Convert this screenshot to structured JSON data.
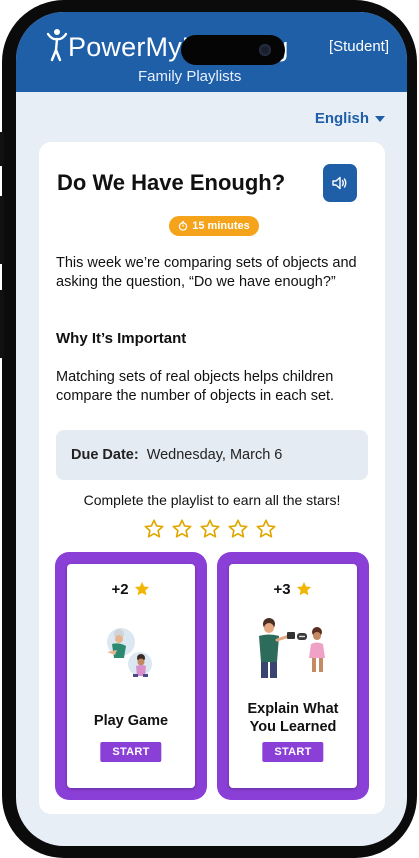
{
  "header": {
    "logo_text": "PowerMyLearning",
    "logo_sub": "Family Playlists",
    "role": "[Student]"
  },
  "language": {
    "selected": "English"
  },
  "activity": {
    "title": "Do We Have Enough?",
    "duration": "15 minutes",
    "description": "This week we’re comparing sets of objects and asking the question, “Do we have enough?”",
    "why_heading": "Why It’s Important",
    "why_text": "Matching sets of real objects helps children compare the number of objects in each set.",
    "due_label": "Due Date:",
    "due_value": "Wednesday, March 6",
    "stars_prompt": "Complete the playlist to earn all the stars!",
    "stars_total": 5,
    "stars_earned": 0
  },
  "tiles": [
    {
      "points": "+2",
      "label": "Play Game",
      "button": "START"
    },
    {
      "points": "+3",
      "label": "Explain What You Learned",
      "button": "START"
    }
  ],
  "colors": {
    "header_blue": "#1f5fa8",
    "badge_orange": "#f5a31a",
    "accent_purple": "#8a3fd6",
    "star_yellow": "#f2b705"
  },
  "icons": [
    "person-logo-icon",
    "speaker-icon",
    "timer-icon",
    "caret-down-icon",
    "star-outline-icon",
    "star-filled-icon"
  ]
}
